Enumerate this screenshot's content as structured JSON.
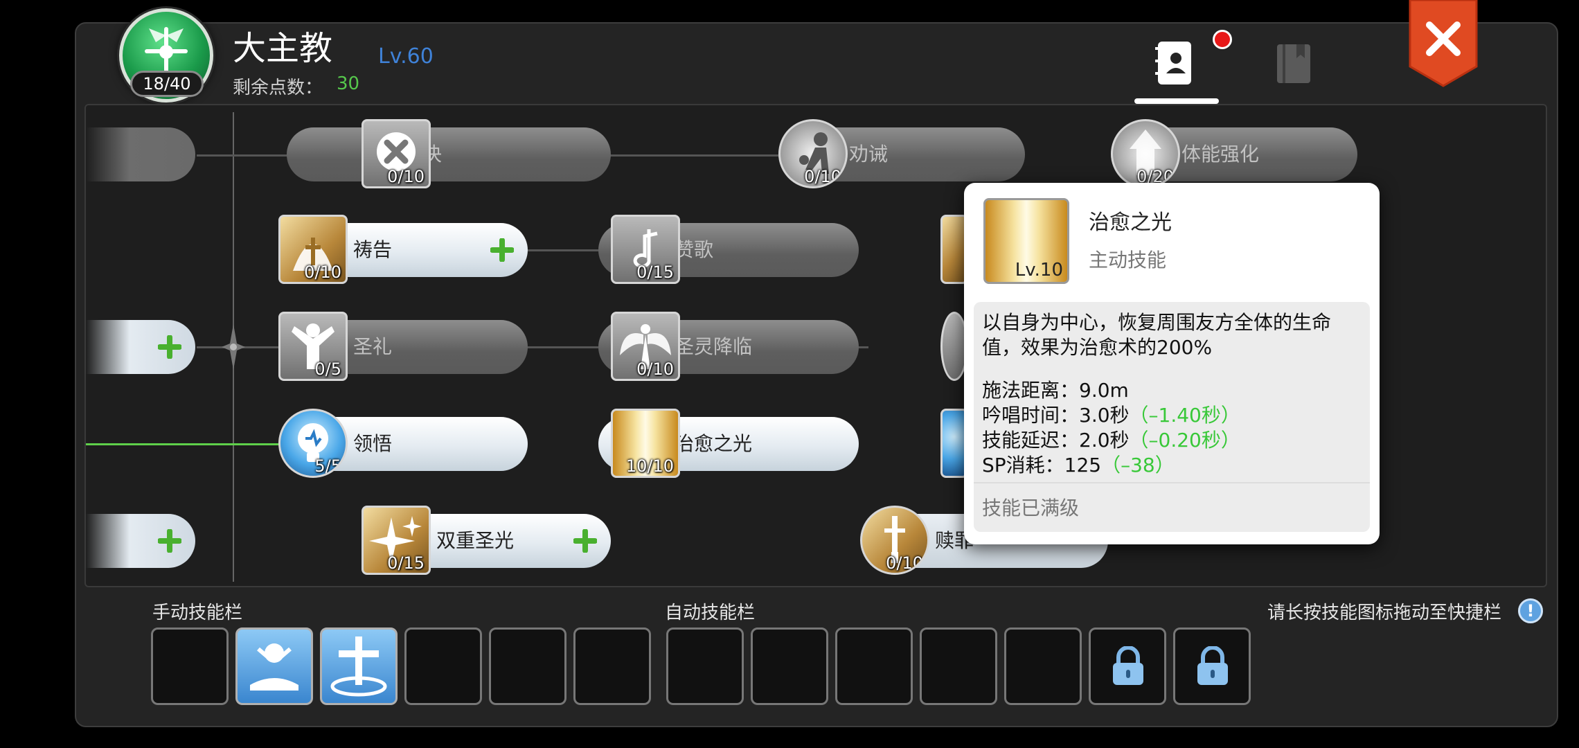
{
  "header": {
    "class_name": "大主教",
    "level": "Lv.60",
    "skill_points_label": "剩余点数：",
    "skill_points_value": "30",
    "points_used": "18/40"
  },
  "skills": [
    {
      "name": "否决",
      "count": "0/10",
      "state": "locked"
    },
    {
      "name": "劝诫",
      "count": "0/10",
      "state": "locked"
    },
    {
      "name": "体能强化",
      "count": "0/20",
      "state": "locked"
    },
    {
      "name": "祷告",
      "count": "0/10",
      "state": "available"
    },
    {
      "name": "赞歌",
      "count": "0/15",
      "state": "locked"
    },
    {
      "name": "圣礼",
      "count": "0/5",
      "state": "locked"
    },
    {
      "name": "圣灵降临",
      "count": "0/10",
      "state": "locked"
    },
    {
      "name": "领悟",
      "count": "5/5",
      "state": "learned"
    },
    {
      "name": "治愈之光",
      "count": "10/10",
      "state": "learned"
    },
    {
      "name": "双重圣光",
      "count": "0/15",
      "state": "available"
    },
    {
      "name": "赎罪",
      "count": "0/10",
      "state": "locked"
    }
  ],
  "tooltip": {
    "name": "治愈之光",
    "level": "Lv.10",
    "type": "主动技能",
    "description": "以自身为中心，恢复周围友方全体的生命值，效果为治愈术的200%",
    "stats": [
      {
        "label": "施法距离：9.0m",
        "bonus": ""
      },
      {
        "label": "吟唱时间：3.0秒",
        "bonus": "（–1.40秒）"
      },
      {
        "label": "技能延迟：2.0秒",
        "bonus": "（–0.20秒）"
      },
      {
        "label": "SP消耗：125",
        "bonus": "（–38）"
      }
    ],
    "status": "技能已满级"
  },
  "bars": {
    "manual_label": "手动技能栏",
    "auto_label": "自动技能栏",
    "hint": "请长按技能图标拖动至快捷栏",
    "hint_icon": "!"
  },
  "colors": {
    "level": "#3f82d8",
    "points": "#56c84c",
    "bonus": "#38c838",
    "notification": "#e81818",
    "close": "#e04a22"
  }
}
